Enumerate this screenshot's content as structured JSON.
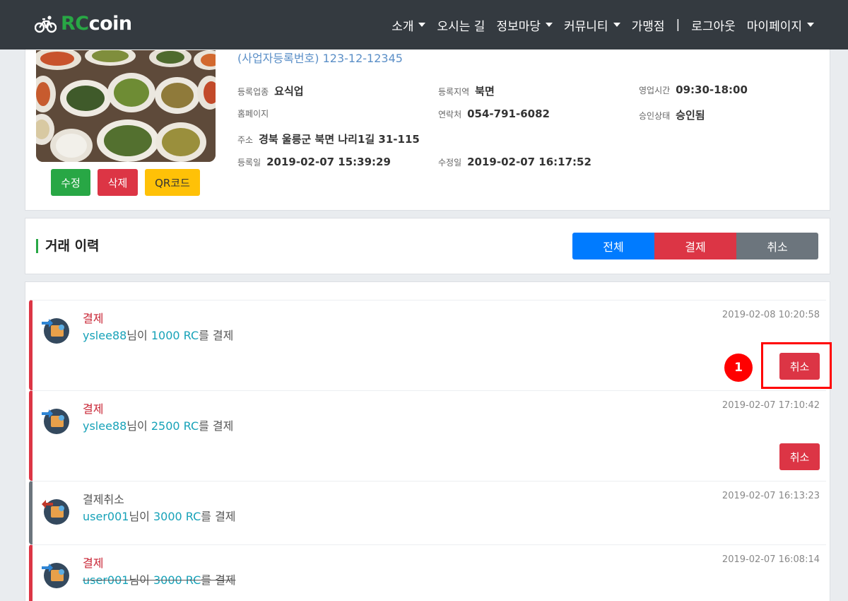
{
  "brand": {
    "rc": "RC",
    "coin": "coin",
    "logo_icon": "bicycle-icon"
  },
  "nav": {
    "items": [
      {
        "label": "소개",
        "dropdown": true
      },
      {
        "label": "오시는 길",
        "dropdown": false
      },
      {
        "label": "정보마당",
        "dropdown": true
      },
      {
        "label": "커뮤니티",
        "dropdown": true
      },
      {
        "label": "가맹점",
        "dropdown": false
      }
    ],
    "separator": "|",
    "logout": "로그아웃",
    "mypage": "마이페이지"
  },
  "store": {
    "bizno": "(사업자등록번호) 123-12-12345",
    "fields": {
      "category_label": "등록업종",
      "category": "요식업",
      "region_label": "등록지역",
      "region": "북면",
      "hours_label": "영업시간",
      "hours": "09:30-18:00",
      "homepage_label": "홈페이지",
      "homepage": "",
      "phone_label": "연락처",
      "phone": "054-791-6082",
      "approval_label": "승인상태",
      "approval": "승인됨",
      "address_label": "주소",
      "address": "경북 울릉군 북면 나리1길 31-115",
      "registered_label": "등록일",
      "registered": "2019-02-07 15:39:29",
      "modified_label": "수정일",
      "modified": "2019-02-07 16:17:52"
    },
    "buttons": {
      "edit": "수정",
      "delete": "삭제",
      "qr": "QR코드"
    }
  },
  "history": {
    "title": "거래 이력",
    "filters": {
      "all": "전체",
      "pay": "결제",
      "cancel": "취소"
    },
    "items": [
      {
        "type": "결제",
        "user": "yslee88",
        "mid": "님이 ",
        "amount": "1000 RC",
        "tail": "를 결제",
        "time": "2019-02-08 10:20:58",
        "cancel_label": "취소"
      },
      {
        "type": "결제",
        "user": "yslee88",
        "mid": "님이 ",
        "amount": "2500 RC",
        "tail": "를 결제",
        "time": "2019-02-07 17:10:42",
        "cancel_label": "취소"
      },
      {
        "type": "결제취소",
        "user": "user001",
        "mid": "님이 ",
        "amount": "3000 RC",
        "tail": "를 결제",
        "time": "2019-02-07 16:13:23"
      },
      {
        "type": "결제",
        "user": "user001",
        "mid": "님이 ",
        "amount": "3000 RC",
        "tail": "를 결제",
        "time": "2019-02-07 16:08:14"
      }
    ]
  },
  "annotation": {
    "number": "1"
  },
  "colors": {
    "navbar": "#343a40",
    "brand_green": "#28a745",
    "danger": "#dc3545",
    "primary": "#007bff",
    "secondary": "#6c757d",
    "warning": "#ffc107",
    "info": "#17a2b8",
    "annotation_red": "#ff0000"
  }
}
